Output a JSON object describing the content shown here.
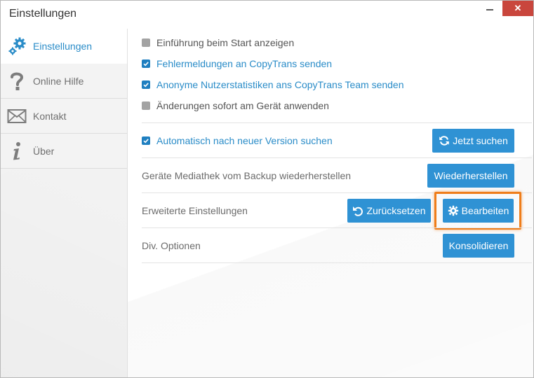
{
  "window": {
    "title": "Einstellungen",
    "close_label": "✕"
  },
  "sidebar": {
    "items": [
      {
        "label": "Einstellungen",
        "icon": "gears-icon"
      },
      {
        "label": "Online Hilfe",
        "icon": "question-icon"
      },
      {
        "label": "Kontakt",
        "icon": "envelope-icon"
      },
      {
        "label": "Über",
        "icon": "info-icon"
      }
    ]
  },
  "settings": {
    "checkboxes": [
      {
        "label": "Einführung beim Start anzeigen",
        "checked": false
      },
      {
        "label": "Fehlermeldungen an CopyTrans senden",
        "checked": true
      },
      {
        "label": "Anonyme Nutzerstatistiken ans CopyTrans Team senden",
        "checked": true
      },
      {
        "label": "Änderungen sofort am Gerät anwenden",
        "checked": false
      }
    ],
    "auto_update": {
      "label": "Automatisch nach neuer Version suchen",
      "checked": true,
      "button": "Jetzt suchen"
    },
    "restore": {
      "label": "Geräte Mediathek vom Backup wiederherstellen",
      "button": "Wiederherstellen"
    },
    "advanced": {
      "label": "Erweiterte Einstellungen",
      "reset_button": "Zurücksetzen",
      "edit_button": "Bearbeiten"
    },
    "misc": {
      "label": "Div. Optionen",
      "button": "Konsolidieren"
    }
  },
  "colors": {
    "accent": "#2f92d4",
    "highlight": "#ef7d1a",
    "close": "#c9463d"
  }
}
